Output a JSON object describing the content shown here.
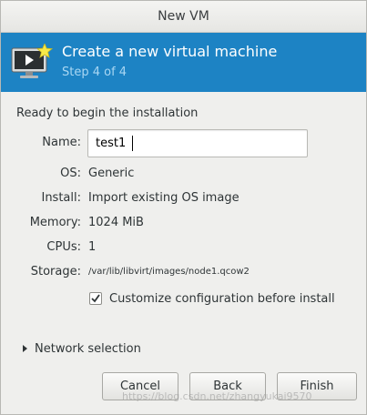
{
  "window": {
    "title": "New VM"
  },
  "header": {
    "title": "Create a new virtual machine",
    "step": "Step 4 of 4",
    "icon": "computer-monitor-with-star-icon"
  },
  "summary": {
    "heading": "Ready to begin the installation",
    "name_label": "Name:",
    "name_value": "test1",
    "os_label": "OS:",
    "os_value": "Generic",
    "install_label": "Install:",
    "install_value": "Import existing OS image",
    "memory_label": "Memory:",
    "memory_value": "1024 MiB",
    "cpus_label": "CPUs:",
    "cpus_value": "1",
    "storage_label": "Storage:",
    "storage_value": "/var/lib/libvirt/images/node1.qcow2"
  },
  "customize": {
    "label": "Customize configuration before install",
    "checked": true
  },
  "network": {
    "label": "Network selection",
    "expanded": false
  },
  "buttons": {
    "cancel": "Cancel",
    "back": "Back",
    "finish": "Finish"
  },
  "watermark": "https://blog.csdn.net/zhangyukai9570"
}
